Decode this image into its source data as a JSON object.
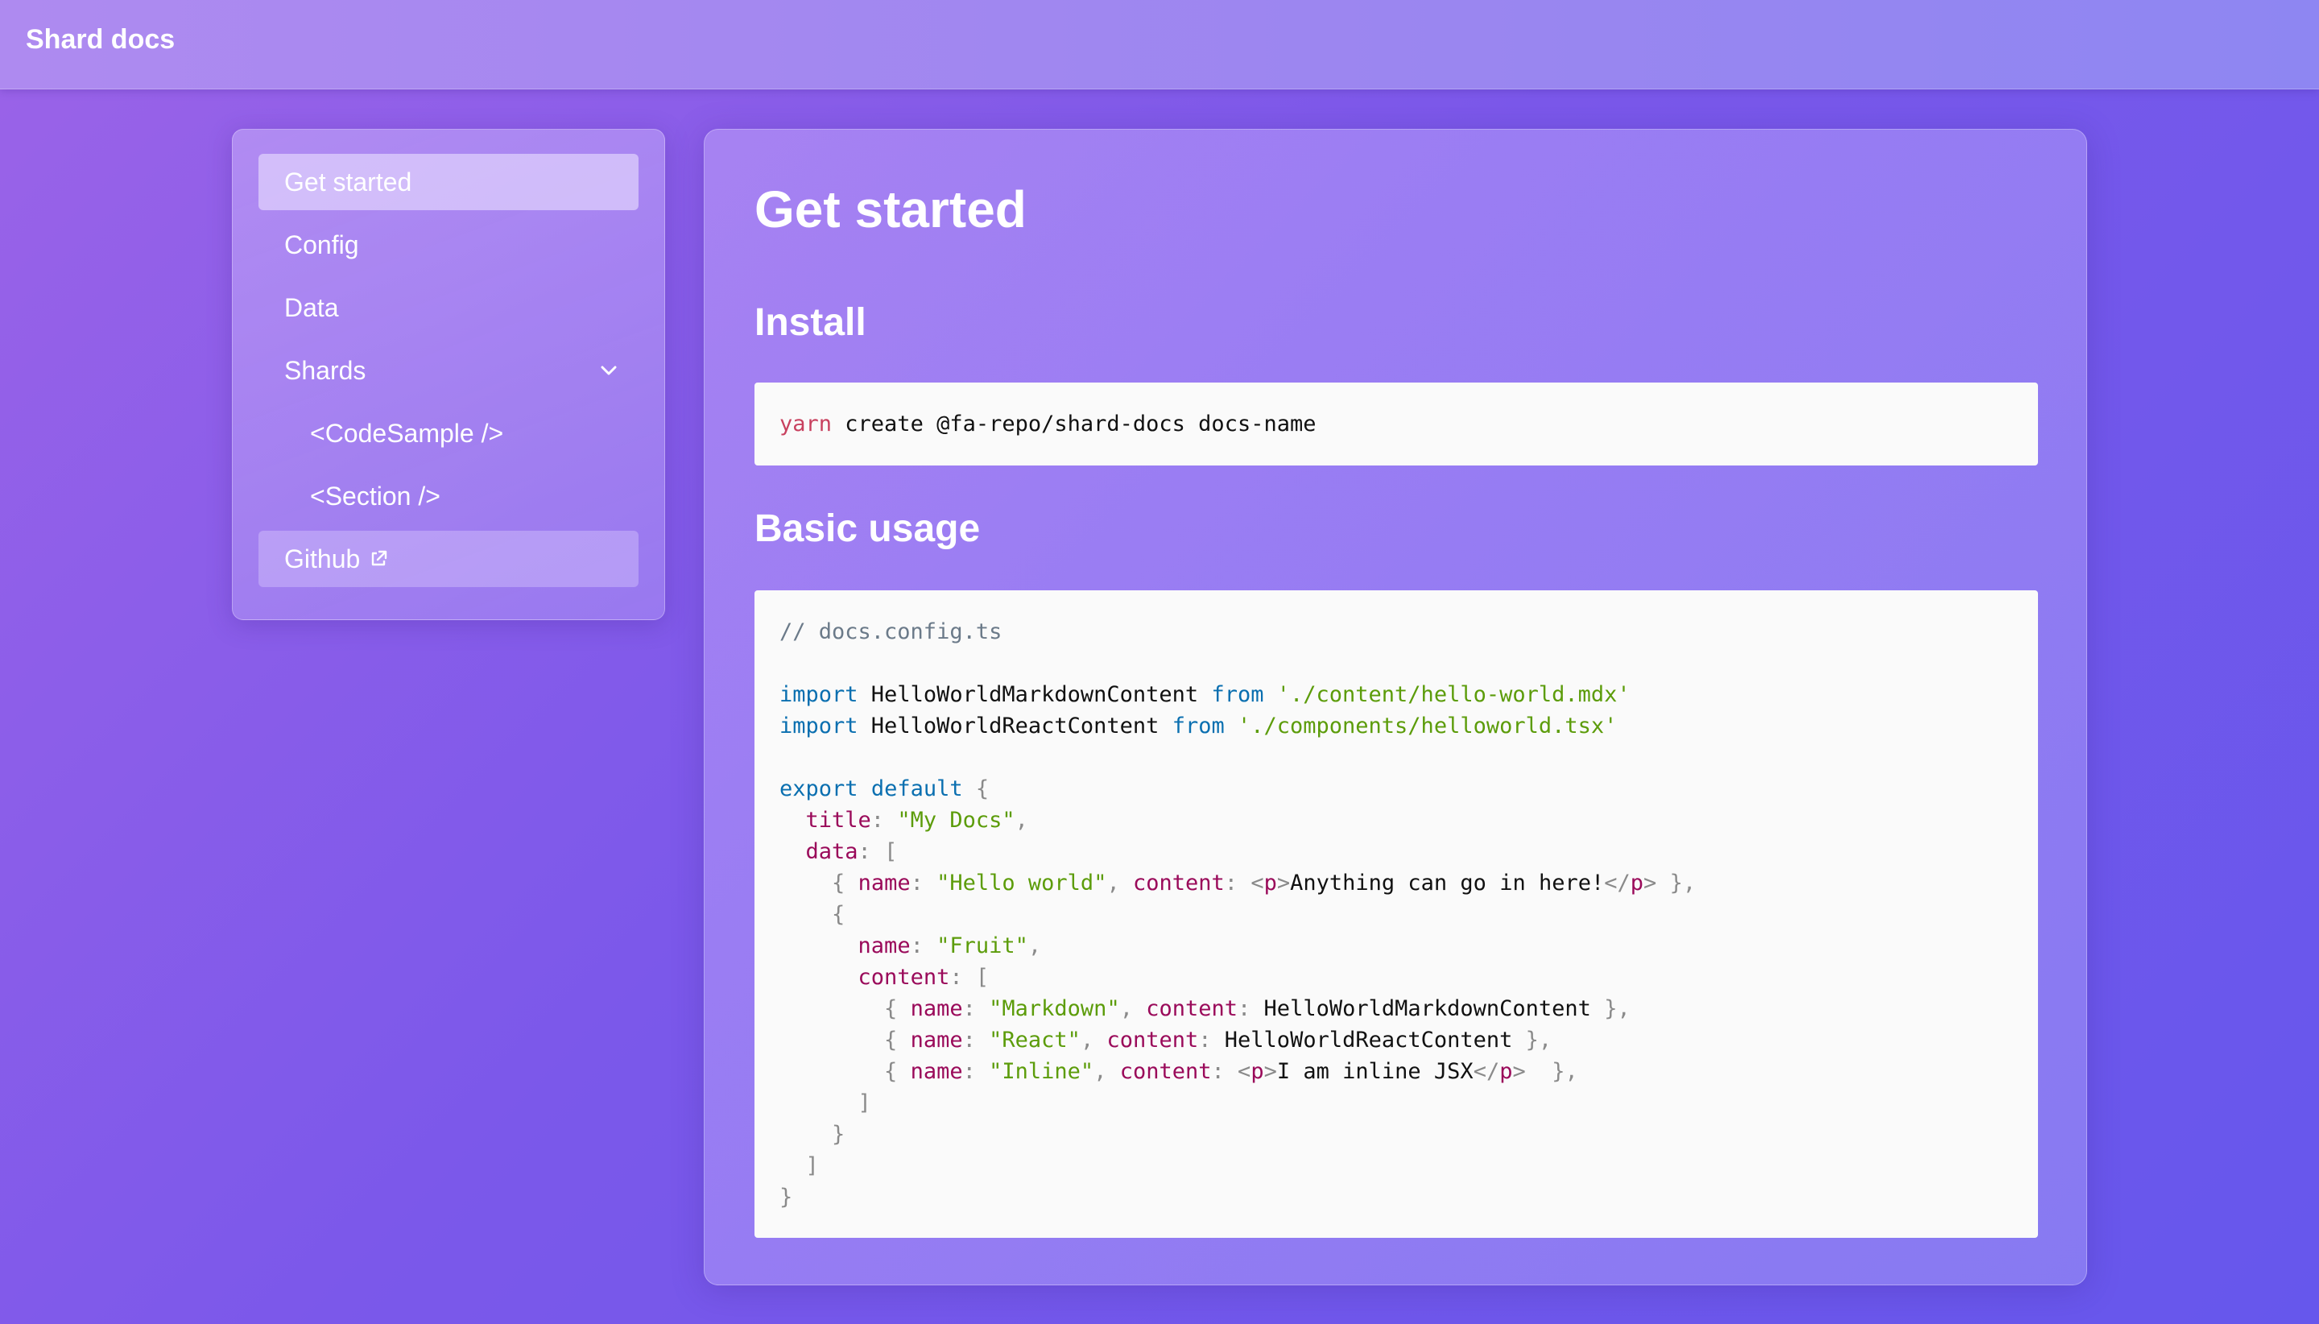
{
  "app": {
    "title": "Shard docs"
  },
  "sidebar": {
    "items": [
      {
        "label": "Get started"
      },
      {
        "label": "Config"
      },
      {
        "label": "Data"
      },
      {
        "label": "Shards"
      },
      {
        "label": "<CodeSample />"
      },
      {
        "label": "<Section />"
      },
      {
        "label": "Github"
      }
    ]
  },
  "main": {
    "title": "Get started",
    "install": {
      "heading": "Install",
      "cmd": "yarn",
      "rest": " create @fa-repo/shard-docs docs-name"
    },
    "usage": {
      "heading": "Basic usage",
      "code": [
        [
          [
            "cm",
            "// docs.config.ts"
          ]
        ],
        [],
        [
          [
            "kw",
            "import"
          ],
          [
            "t",
            " HelloWorldMarkdownContent "
          ],
          [
            "kw",
            "from"
          ],
          [
            "t",
            " "
          ],
          [
            "str",
            "'./content/hello-world.mdx'"
          ]
        ],
        [
          [
            "kw",
            "import"
          ],
          [
            "t",
            " HelloWorldReactContent "
          ],
          [
            "kw",
            "from"
          ],
          [
            "t",
            " "
          ],
          [
            "str",
            "'./components/helloworld.tsx'"
          ]
        ],
        [],
        [
          [
            "kw",
            "export"
          ],
          [
            "t",
            " "
          ],
          [
            "kw",
            "default"
          ],
          [
            "t",
            " "
          ],
          [
            "pn",
            "{"
          ]
        ],
        [
          [
            "t",
            "  "
          ],
          [
            "prop",
            "title"
          ],
          [
            "pn",
            ":"
          ],
          [
            "t",
            " "
          ],
          [
            "str",
            "\"My Docs\""
          ],
          [
            "pn",
            ","
          ]
        ],
        [
          [
            "t",
            "  "
          ],
          [
            "prop",
            "data"
          ],
          [
            "pn",
            ":"
          ],
          [
            "t",
            " "
          ],
          [
            "pn",
            "["
          ]
        ],
        [
          [
            "t",
            "    "
          ],
          [
            "pn",
            "{"
          ],
          [
            "t",
            " "
          ],
          [
            "prop",
            "name"
          ],
          [
            "pn",
            ":"
          ],
          [
            "t",
            " "
          ],
          [
            "str",
            "\"Hello world\""
          ],
          [
            "pn",
            ","
          ],
          [
            "t",
            " "
          ],
          [
            "prop",
            "content"
          ],
          [
            "pn",
            ":"
          ],
          [
            "t",
            " "
          ],
          [
            "pn",
            "<"
          ],
          [
            "tag",
            "p"
          ],
          [
            "pn",
            ">"
          ],
          [
            "t",
            "Anything can go in here!"
          ],
          [
            "pn",
            "</"
          ],
          [
            "tag",
            "p"
          ],
          [
            "pn",
            ">"
          ],
          [
            "t",
            " "
          ],
          [
            "pn",
            "},"
          ]
        ],
        [
          [
            "t",
            "    "
          ],
          [
            "pn",
            "{"
          ]
        ],
        [
          [
            "t",
            "      "
          ],
          [
            "prop",
            "name"
          ],
          [
            "pn",
            ":"
          ],
          [
            "t",
            " "
          ],
          [
            "str",
            "\"Fruit\""
          ],
          [
            "pn",
            ","
          ]
        ],
        [
          [
            "t",
            "      "
          ],
          [
            "prop",
            "content"
          ],
          [
            "pn",
            ":"
          ],
          [
            "t",
            " "
          ],
          [
            "pn",
            "["
          ]
        ],
        [
          [
            "t",
            "        "
          ],
          [
            "pn",
            "{"
          ],
          [
            "t",
            " "
          ],
          [
            "prop",
            "name"
          ],
          [
            "pn",
            ":"
          ],
          [
            "t",
            " "
          ],
          [
            "str",
            "\"Markdown\""
          ],
          [
            "pn",
            ","
          ],
          [
            "t",
            " "
          ],
          [
            "prop",
            "content"
          ],
          [
            "pn",
            ":"
          ],
          [
            "t",
            " HelloWorldMarkdownContent "
          ],
          [
            "pn",
            "},"
          ]
        ],
        [
          [
            "t",
            "        "
          ],
          [
            "pn",
            "{"
          ],
          [
            "t",
            " "
          ],
          [
            "prop",
            "name"
          ],
          [
            "pn",
            ":"
          ],
          [
            "t",
            " "
          ],
          [
            "str",
            "\"React\""
          ],
          [
            "pn",
            ","
          ],
          [
            "t",
            " "
          ],
          [
            "prop",
            "content"
          ],
          [
            "pn",
            ":"
          ],
          [
            "t",
            " HelloWorldReactContent "
          ],
          [
            "pn",
            "},"
          ]
        ],
        [
          [
            "t",
            "        "
          ],
          [
            "pn",
            "{"
          ],
          [
            "t",
            " "
          ],
          [
            "prop",
            "name"
          ],
          [
            "pn",
            ":"
          ],
          [
            "t",
            " "
          ],
          [
            "str",
            "\"Inline\""
          ],
          [
            "pn",
            ","
          ],
          [
            "t",
            " "
          ],
          [
            "prop",
            "content"
          ],
          [
            "pn",
            ":"
          ],
          [
            "t",
            " "
          ],
          [
            "pn",
            "<"
          ],
          [
            "tag",
            "p"
          ],
          [
            "pn",
            ">"
          ],
          [
            "t",
            "I am inline JSX"
          ],
          [
            "pn",
            "</"
          ],
          [
            "tag",
            "p"
          ],
          [
            "pn",
            ">"
          ],
          [
            "t",
            "  "
          ],
          [
            "pn",
            "},"
          ]
        ],
        [
          [
            "t",
            "      "
          ],
          [
            "pn",
            "]"
          ]
        ],
        [
          [
            "t",
            "    "
          ],
          [
            "pn",
            "}"
          ]
        ],
        [
          [
            "t",
            "  "
          ],
          [
            "pn",
            "]"
          ]
        ],
        [
          [
            "pn",
            "}"
          ]
        ]
      ]
    }
  }
}
